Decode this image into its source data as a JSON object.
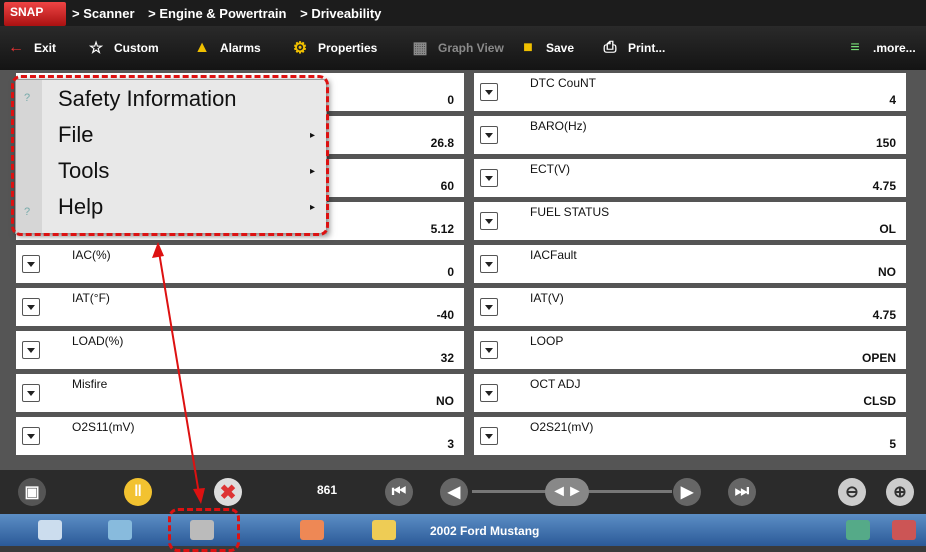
{
  "breadcrumb": {
    "home_label": "",
    "items": [
      "> Scanner",
      "> Engine & Powertrain",
      "> Driveability"
    ]
  },
  "toolbar": {
    "exit": "Exit",
    "custom": "Custom",
    "alarms": "Alarms",
    "properties": "Properties",
    "graph_view": "Graph View",
    "save": "Save",
    "print": "Print...",
    "more": ".more..."
  },
  "menu": {
    "items": [
      {
        "label": "Safety Information"
      },
      {
        "label": "File"
      },
      {
        "label": "Tools"
      },
      {
        "label": "Help"
      }
    ]
  },
  "left_rows": [
    {
      "label": "",
      "value": "0"
    },
    {
      "label": "",
      "value": "26.8"
    },
    {
      "label": "",
      "value": "60"
    },
    {
      "label": "",
      "value": "5.12"
    },
    {
      "label": "IAC(%)",
      "value": "0"
    },
    {
      "label": "IAT(°F)",
      "value": "-40"
    },
    {
      "label": "LOAD(%)",
      "value": "32"
    },
    {
      "label": "Misfire",
      "value": "NO"
    },
    {
      "label": "O2S11(mV)",
      "value": "3"
    }
  ],
  "right_rows": [
    {
      "label": "DTC CouNT",
      "value": "4"
    },
    {
      "label": "BARO(Hz)",
      "value": "150"
    },
    {
      "label": "ECT(V)",
      "value": "4.75"
    },
    {
      "label": "FUEL STATUS",
      "value": "OL"
    },
    {
      "label": "IACFault",
      "value": "NO"
    },
    {
      "label": "IAT(V)",
      "value": "4.75"
    },
    {
      "label": "LOOP",
      "value": "OPEN"
    },
    {
      "label": "OCT ADJ",
      "value": "CLSD"
    },
    {
      "label": "O2S21(mV)",
      "value": "5"
    }
  ],
  "controls": {
    "frame_count": "861"
  },
  "taskbar": {
    "vehicle": "2002 Ford Mustang"
  },
  "colors": {
    "annotation_red": "#d11",
    "taskbar_blue": "#3a6aa8"
  },
  "icons": [
    "exit-icon",
    "star-icon",
    "alarm-bell-icon",
    "properties-icon",
    "graph-icon",
    "save-icon",
    "print-icon",
    "more-icon",
    "pause-icon",
    "stop-icon",
    "zoom-out-icon",
    "zoom-in-icon",
    "home-icon"
  ]
}
